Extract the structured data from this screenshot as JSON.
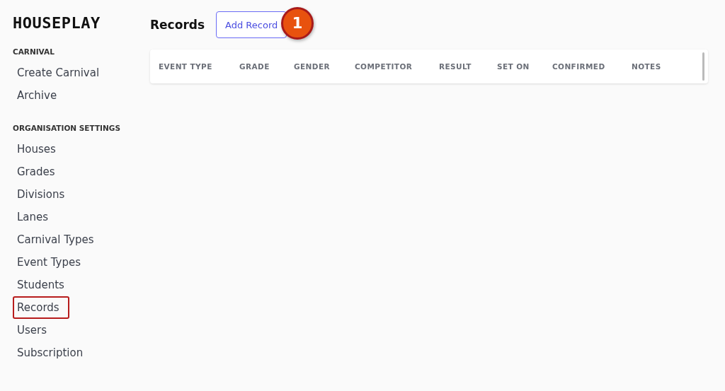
{
  "brand": "HOUSEPLAY",
  "sidebar": {
    "sections": [
      {
        "heading": "CARNIVAL",
        "items": [
          {
            "label": "Create Carnival",
            "selected": false
          },
          {
            "label": "Archive",
            "selected": false
          }
        ]
      },
      {
        "heading": "ORGANISATION SETTINGS",
        "items": [
          {
            "label": "Houses",
            "selected": false
          },
          {
            "label": "Grades",
            "selected": false
          },
          {
            "label": "Divisions",
            "selected": false
          },
          {
            "label": "Lanes",
            "selected": false
          },
          {
            "label": "Carnival Types",
            "selected": false
          },
          {
            "label": "Event Types",
            "selected": false
          },
          {
            "label": "Students",
            "selected": false
          },
          {
            "label": "Records",
            "selected": true
          },
          {
            "label": "Users",
            "selected": false
          },
          {
            "label": "Subscription",
            "selected": false
          }
        ]
      }
    ]
  },
  "page": {
    "title": "Records",
    "add_button": "Add Record",
    "step_marker": "1"
  },
  "table": {
    "columns": [
      "EVENT TYPE",
      "GRADE",
      "GENDER",
      "COMPETITOR",
      "RESULT",
      "SET ON",
      "CONFIRMED",
      "NOTES"
    ]
  }
}
